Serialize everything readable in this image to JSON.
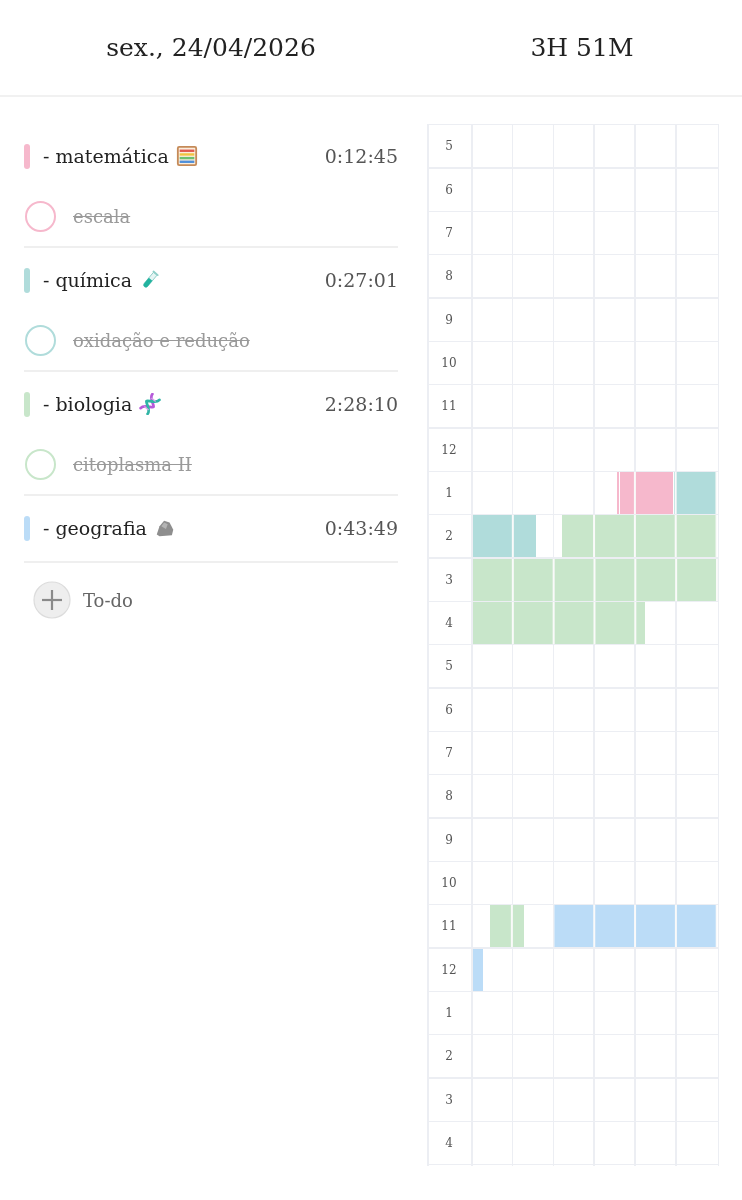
{
  "header": {
    "date": "sex., 24/04/2026",
    "total": "3H 51M"
  },
  "subjects": [
    {
      "name": "- matemática",
      "time": "0:12:45",
      "color": "#f6b8cc",
      "tasks": [
        {
          "text": "escala",
          "checked": false,
          "done": true
        }
      ]
    },
    {
      "name": "- química",
      "time": "0:27:01",
      "color": "#b0dcdb",
      "tasks": [
        {
          "text": "oxidação e redução",
          "checked": false,
          "done": true
        }
      ]
    },
    {
      "name": "- biologia",
      "time": "2:28:10",
      "color": "#c8e6ca",
      "tasks": [
        {
          "text": "citoplasma II",
          "checked": false,
          "done": true
        }
      ]
    },
    {
      "name": "- geografia",
      "time": "0:43:49",
      "color": "#bbdcf7"
    }
  ],
  "add_button": {
    "label": "To-do"
  },
  "timeline": {
    "hours": [
      "5",
      "6",
      "7",
      "8",
      "9",
      "10",
      "11",
      "12",
      "1",
      "2",
      "3",
      "4",
      "5",
      "6",
      "7",
      "8",
      "9",
      "10",
      "11",
      "12",
      "1",
      "2",
      "3",
      "4"
    ]
  }
}
